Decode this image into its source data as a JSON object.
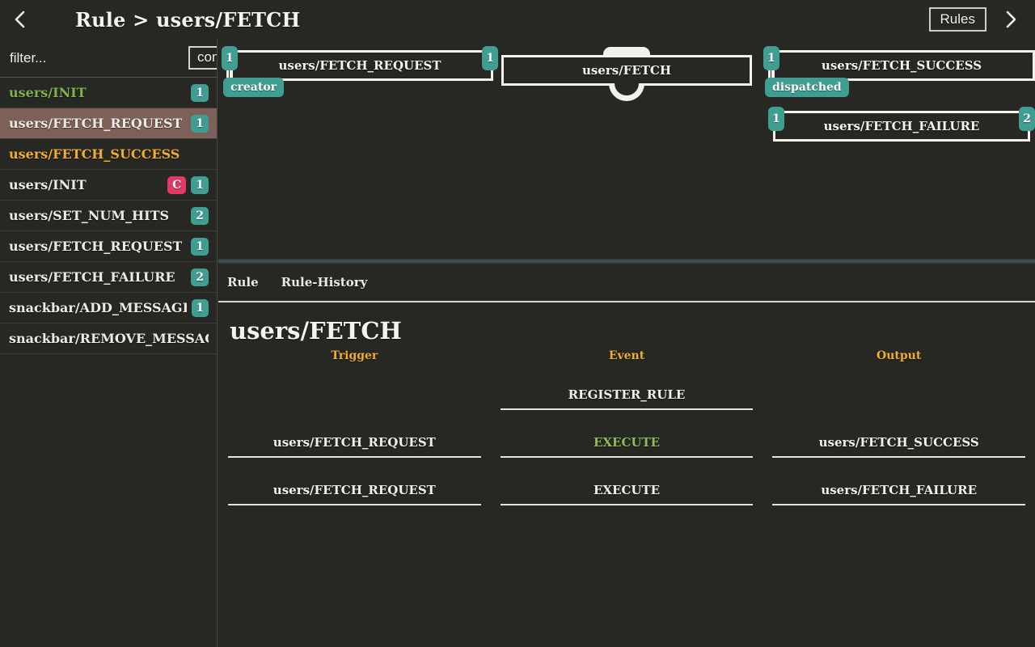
{
  "header": {
    "back_icon": "chevron-left-icon",
    "title": "Rule > users/FETCH",
    "rules_button": "Rules",
    "forward_icon": "chevron-right-icon"
  },
  "sidebar": {
    "filter": {
      "placeholder": "filter...",
      "value": ""
    },
    "commit_label": "commit",
    "items": [
      {
        "label": "users/INIT",
        "count": "1",
        "tag": "",
        "style": "green"
      },
      {
        "label": "users/FETCH_REQUEST",
        "count": "1",
        "tag": "",
        "style": "selected"
      },
      {
        "label": "users/FETCH_SUCCESS",
        "count": "",
        "tag": "",
        "style": "amber"
      },
      {
        "label": "users/INIT",
        "count": "1",
        "tag": "C",
        "style": "normal"
      },
      {
        "label": "users/SET_NUM_HITS",
        "count": "2",
        "tag": "",
        "style": "normal"
      },
      {
        "label": "users/FETCH_REQUEST",
        "count": "1",
        "tag": "",
        "style": "normal"
      },
      {
        "label": "users/FETCH_FAILURE",
        "count": "2",
        "tag": "",
        "style": "normal"
      },
      {
        "label": "snackbar/ADD_MESSAGE",
        "count": "1",
        "tag": "",
        "style": "normal"
      },
      {
        "label": "snackbar/REMOVE_MESSAGE",
        "count": "",
        "tag": "",
        "style": "normal"
      }
    ]
  },
  "graph": {
    "nodes": [
      {
        "label": "users/FETCH_REQUEST",
        "left_port": "1",
        "right_port": "1",
        "pill": "creator",
        "selected": false
      },
      {
        "label": "users/FETCH",
        "left_port": "",
        "right_port": "",
        "pill": "",
        "selected": true
      },
      {
        "label": "users/FETCH_SUCCESS",
        "left_port": "1",
        "right_port": "",
        "pill": "dispatched",
        "selected": false
      },
      {
        "label": "users/FETCH_FAILURE",
        "left_port": "1",
        "right_port": "2",
        "pill": "",
        "selected": false
      }
    ]
  },
  "detail": {
    "tabs": [
      {
        "label": "Rule"
      },
      {
        "label": "Rule-History"
      }
    ],
    "rule_title": "users/FETCH",
    "columns": [
      "Trigger",
      "Event",
      "Output"
    ],
    "rows": [
      {
        "trigger": "",
        "event": "REGISTER_RULE",
        "output": "",
        "event_style": "normal"
      },
      {
        "trigger": "users/FETCH_REQUEST",
        "event": "EXECUTE",
        "output": "users/FETCH_SUCCESS",
        "event_style": "green"
      },
      {
        "trigger": "users/FETCH_REQUEST",
        "event": "EXECUTE",
        "output": "users/FETCH_FAILURE",
        "event_style": "normal"
      }
    ]
  },
  "colors": {
    "background": "#272723",
    "accent_teal": "#3f9e91",
    "accent_pink": "#e23a68",
    "accent_amber": "#f0ad2e",
    "accent_green": "#8fbc5a",
    "selected_row": "#7d6158",
    "foreground": "#f2f0ea"
  }
}
